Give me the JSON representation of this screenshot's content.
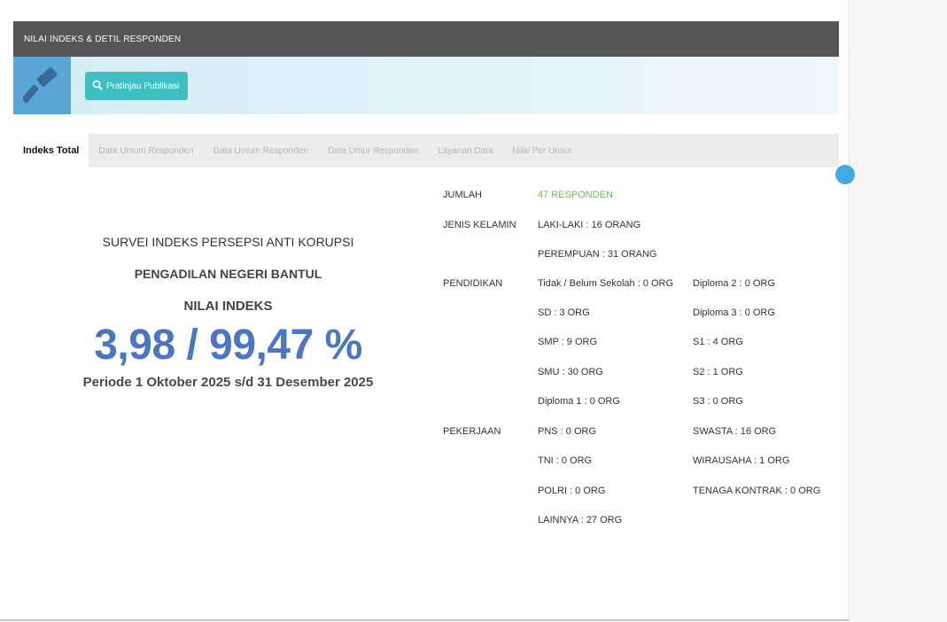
{
  "header": {
    "title": "NILAI INDEKS & DETIL RESPONDEN"
  },
  "banner": {
    "button_label": "Pratinjau Publikasi"
  },
  "tabs": [
    {
      "label": "Indeks Total",
      "active": true
    },
    {
      "label": "Data Umum Responden",
      "active": false
    },
    {
      "label": "Data Umum Responden",
      "active": false
    },
    {
      "label": "Data Umur Responden",
      "active": false
    },
    {
      "label": "Layanan Data",
      "active": false
    },
    {
      "label": "Nilai Per Unsur",
      "active": false
    }
  ],
  "summary": {
    "survey_title": "SURVEI INDEKS PERSEPSI ANTI KORUPSI",
    "court_name": "PENGADILAN NEGERI BANTUL",
    "index_label": "NILAI INDEKS",
    "index_value": "3,98 / 99,47 %",
    "period": "Periode 1 Oktober 2025 s/d 31 Desember 2025"
  },
  "stats": {
    "jumlah": {
      "label": "JUMLAH",
      "value": "47 RESPONDEN"
    },
    "jenis_kelamin": {
      "label": "JENIS KELAMIN",
      "items": [
        "LAKI-LAKI : 16 ORANG",
        "PEREMPUAN : 31 ORANG"
      ]
    },
    "pendidikan": {
      "label": "PENDIDIKAN",
      "col1": [
        "Tidak / Belum Sekolah : 0 ORG",
        "SD : 3 ORG",
        "SMP : 9 ORG",
        "SMU : 30 ORG",
        "Diploma 1 : 0 ORG"
      ],
      "col2": [
        "Diploma 2 : 0 ORG",
        "Diploma 3 : 0 ORG",
        "S1 : 4 ORG",
        "S2 : 1 ORG",
        "S3 : 0 ORG"
      ]
    },
    "pekerjaan": {
      "label": "PEKERJAAN",
      "col1": [
        "PNS : 0 ORG",
        "TNI : 0 ORG",
        "POLRI : 0 ORG",
        "LAINNYA : 27 ORG"
      ],
      "col2": [
        "SWASTA : 16 ORG",
        "WIRAUSAHA : 1 ORG",
        "TENAGA KONTRAK : 0 ORG"
      ]
    }
  },
  "colors": {
    "header_bg": "#555555",
    "banner_icon": "#5aa6d9",
    "button": "#3fbfc0",
    "index_value": "#4a76c3",
    "responden_green": "#6cba5a"
  }
}
